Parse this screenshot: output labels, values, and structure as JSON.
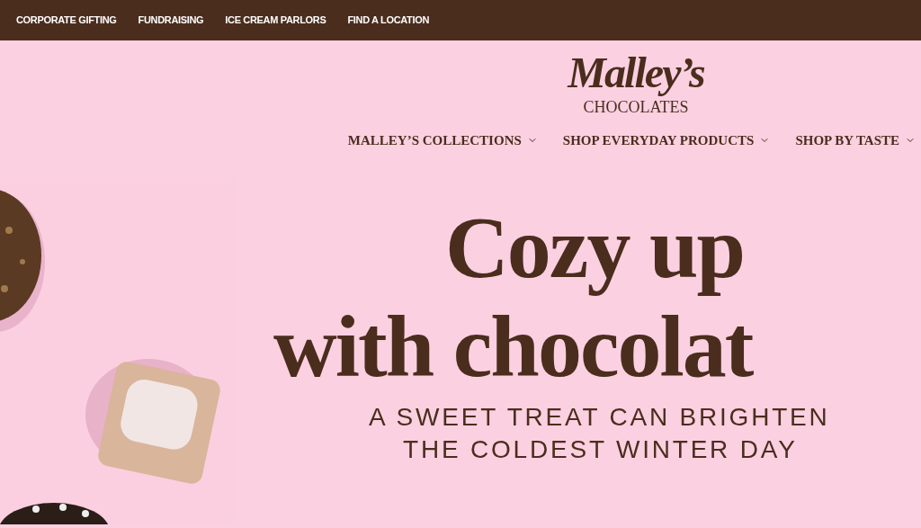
{
  "top_bar": {
    "links": [
      "CORPORATE GIFTING",
      "FUNDRAISING",
      "ICE CREAM PARLORS",
      "FIND A LOCATION"
    ]
  },
  "logo": {
    "script": "Malley’s",
    "subtitle": "CHOCOLATES"
  },
  "main_nav": {
    "items": [
      {
        "label": "MALLEY’S COLLECTIONS"
      },
      {
        "label": "SHOP EVERYDAY PRODUCTS"
      },
      {
        "label": "SHOP BY TASTE"
      }
    ]
  },
  "hero": {
    "kind": "picture",
    "headline": [
      "Cozy up",
      "with chocolat"
    ],
    "subheadline": [
      "A SWEET TREAT CAN BRIGHTEN",
      "THE COLDEST WINTER DAY"
    ]
  }
}
